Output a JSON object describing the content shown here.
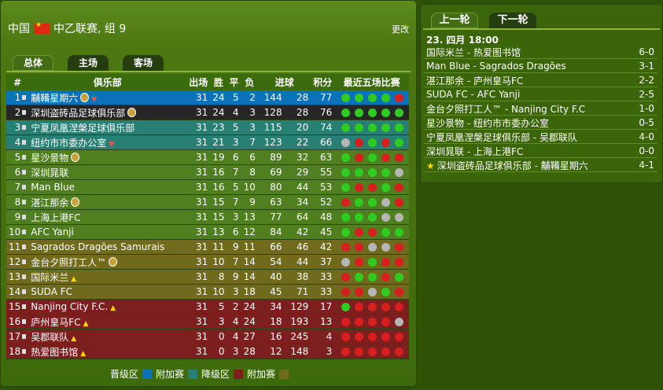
{
  "header": {
    "country": "中国",
    "league": "中乙联赛, 组 9",
    "change": "更改"
  },
  "tabs": [
    "总体",
    "主场",
    "客场"
  ],
  "columns": {
    "rank": "#",
    "club": "俱乐部",
    "played": "出场",
    "won": "胜",
    "drawn": "平",
    "lost": "负",
    "goals": "进球",
    "points": "积分",
    "form": "最近五场比赛"
  },
  "standings": [
    {
      "rank": "1",
      "club": "黼鞴星期六",
      "p": "31",
      "w": "24",
      "d": "5",
      "l": "2",
      "gf": "144",
      "ga": "28",
      "pts": "77",
      "badge": true,
      "arrow": "down",
      "color": "blue",
      "form": [
        "w",
        "w",
        "w",
        "w",
        "l"
      ]
    },
    {
      "rank": "2",
      "club": "深圳盗砖品足球俱乐部",
      "p": "31",
      "w": "24",
      "d": "4",
      "l": "3",
      "gf": "128",
      "ga": "28",
      "pts": "76",
      "badge": true,
      "arrow": "",
      "color": "dark",
      "form": [
        "w",
        "w",
        "w",
        "w",
        "w"
      ]
    },
    {
      "rank": "3",
      "club": "宁夏凤凰涅槃足球俱乐部",
      "p": "31",
      "w": "23",
      "d": "5",
      "l": "3",
      "gf": "115",
      "ga": "20",
      "pts": "74",
      "badge": false,
      "arrow": "",
      "color": "teal",
      "form": [
        "w",
        "w",
        "w",
        "w",
        "w"
      ]
    },
    {
      "rank": "4",
      "club": "纽约市市委办公室",
      "p": "31",
      "w": "21",
      "d": "3",
      "l": "7",
      "gf": "123",
      "ga": "22",
      "pts": "66",
      "badge": false,
      "arrow": "down",
      "color": "teal",
      "form": [
        "d",
        "l",
        "w",
        "l",
        "w"
      ]
    },
    {
      "rank": "5",
      "club": "星沙景物",
      "p": "31",
      "w": "19",
      "d": "6",
      "l": "6",
      "gf": "89",
      "ga": "32",
      "pts": "63",
      "badge": true,
      "arrow": "",
      "color": "green",
      "form": [
        "w",
        "l",
        "w",
        "l",
        "l"
      ]
    },
    {
      "rank": "6",
      "club": "深圳晁联",
      "p": "31",
      "w": "16",
      "d": "7",
      "l": "8",
      "gf": "69",
      "ga": "29",
      "pts": "55",
      "badge": false,
      "arrow": "",
      "color": "green",
      "form": [
        "w",
        "w",
        "w",
        "w",
        "d"
      ]
    },
    {
      "rank": "7",
      "club": "Man Blue",
      "p": "31",
      "w": "16",
      "d": "5",
      "l": "10",
      "gf": "80",
      "ga": "44",
      "pts": "53",
      "badge": false,
      "arrow": "",
      "color": "green",
      "form": [
        "w",
        "l",
        "l",
        "w",
        "l"
      ]
    },
    {
      "rank": "8",
      "club": "湛江那余",
      "p": "31",
      "w": "15",
      "d": "7",
      "l": "9",
      "gf": "63",
      "ga": "34",
      "pts": "52",
      "badge": true,
      "arrow": "",
      "color": "green",
      "form": [
        "l",
        "w",
        "w",
        "d",
        "l"
      ]
    },
    {
      "rank": "9",
      "club": "上海上港FC",
      "p": "31",
      "w": "15",
      "d": "3",
      "l": "13",
      "gf": "77",
      "ga": "64",
      "pts": "48",
      "badge": false,
      "arrow": "",
      "color": "green",
      "form": [
        "w",
        "w",
        "w",
        "d",
        "d"
      ]
    },
    {
      "rank": "10",
      "club": "AFC Yanji",
      "p": "31",
      "w": "13",
      "d": "6",
      "l": "12",
      "gf": "84",
      "ga": "42",
      "pts": "45",
      "badge": false,
      "arrow": "",
      "color": "green",
      "form": [
        "w",
        "l",
        "l",
        "w",
        "w"
      ]
    },
    {
      "rank": "11",
      "club": "Sagrados Dragões Samurais",
      "p": "31",
      "w": "11",
      "d": "9",
      "l": "11",
      "gf": "66",
      "ga": "46",
      "pts": "42",
      "badge": false,
      "arrow": "",
      "color": "olive",
      "form": [
        "l",
        "l",
        "d",
        "d",
        "l"
      ]
    },
    {
      "rank": "12",
      "club": "金台夕照打工人™",
      "p": "31",
      "w": "10",
      "d": "7",
      "l": "14",
      "gf": "54",
      "ga": "44",
      "pts": "37",
      "badge": true,
      "arrow": "",
      "color": "olive",
      "form": [
        "d",
        "l",
        "w",
        "l",
        "l"
      ]
    },
    {
      "rank": "13",
      "club": "国际米兰",
      "p": "31",
      "w": "8",
      "d": "9",
      "l": "14",
      "gf": "40",
      "ga": "38",
      "pts": "33",
      "badge": false,
      "arrow": "up",
      "color": "olive",
      "form": [
        "l",
        "w",
        "w",
        "l",
        "w"
      ]
    },
    {
      "rank": "14",
      "club": "SUDA FC",
      "p": "31",
      "w": "10",
      "d": "3",
      "l": "18",
      "gf": "45",
      "ga": "71",
      "pts": "33",
      "badge": false,
      "arrow": "",
      "color": "olive",
      "form": [
        "l",
        "l",
        "d",
        "w",
        "l"
      ]
    },
    {
      "rank": "15",
      "club": "Nanjing City F.C.",
      "p": "31",
      "w": "5",
      "d": "2",
      "l": "24",
      "gf": "34",
      "ga": "129",
      "pts": "17",
      "badge": false,
      "arrow": "up",
      "color": "red",
      "form": [
        "w",
        "l",
        "l",
        "l",
        "l"
      ]
    },
    {
      "rank": "16",
      "club": "庐州皇马FC",
      "p": "31",
      "w": "3",
      "d": "4",
      "l": "24",
      "gf": "18",
      "ga": "193",
      "pts": "13",
      "badge": false,
      "arrow": "up",
      "color": "red",
      "form": [
        "l",
        "l",
        "l",
        "l",
        "d"
      ]
    },
    {
      "rank": "17",
      "club": "吴郡联队",
      "p": "31",
      "w": "0",
      "d": "4",
      "l": "27",
      "gf": "16",
      "ga": "245",
      "pts": "4",
      "badge": false,
      "arrow": "up",
      "color": "red",
      "form": [
        "l",
        "l",
        "l",
        "l",
        "l"
      ]
    },
    {
      "rank": "18",
      "club": "热爱图书馆",
      "p": "31",
      "w": "0",
      "d": "3",
      "l": "28",
      "gf": "12",
      "ga": "148",
      "pts": "3",
      "badge": false,
      "arrow": "up",
      "color": "red",
      "form": [
        "l",
        "l",
        "l",
        "l",
        "l"
      ]
    }
  ],
  "legend": [
    {
      "label": "晋级区",
      "color": "#0a73b7"
    },
    {
      "label": "附加赛",
      "color": "#287f73"
    },
    {
      "label": "降级区",
      "color": "#7d1f1f"
    },
    {
      "label": "附加赛",
      "color": "#6f6a1c"
    }
  ],
  "round_tabs": {
    "prev": "上一轮",
    "next": "下一轮"
  },
  "round_date": "23. 四月 18:00",
  "matches": [
    {
      "teams": "国际米兰 - 热爱图书馆",
      "score": "6-0",
      "star": false
    },
    {
      "teams": "Man Blue - Sagrados Dragões",
      "score": "3-1",
      "star": false
    },
    {
      "teams": "湛江那余 - 庐州皇马FC",
      "score": "2-2",
      "star": false
    },
    {
      "teams": "SUDA FC - AFC Yanji",
      "score": "2-5",
      "star": false
    },
    {
      "teams": "金台夕照打工人™ - Nanjing City F.C",
      "score": "1-0",
      "star": false
    },
    {
      "teams": "星沙景物 - 纽约市市委办公室",
      "score": "0-5",
      "star": false
    },
    {
      "teams": "宁夏凤凰涅槃足球俱乐部 - 吴郡联队",
      "score": "4-0",
      "star": false
    },
    {
      "teams": "深圳晁联 - 上海上港FC",
      "score": "0-0",
      "star": false
    },
    {
      "teams": "深圳盗砖品足球俱乐部 - 黼鞴星期六",
      "score": "4-1",
      "star": true
    }
  ]
}
